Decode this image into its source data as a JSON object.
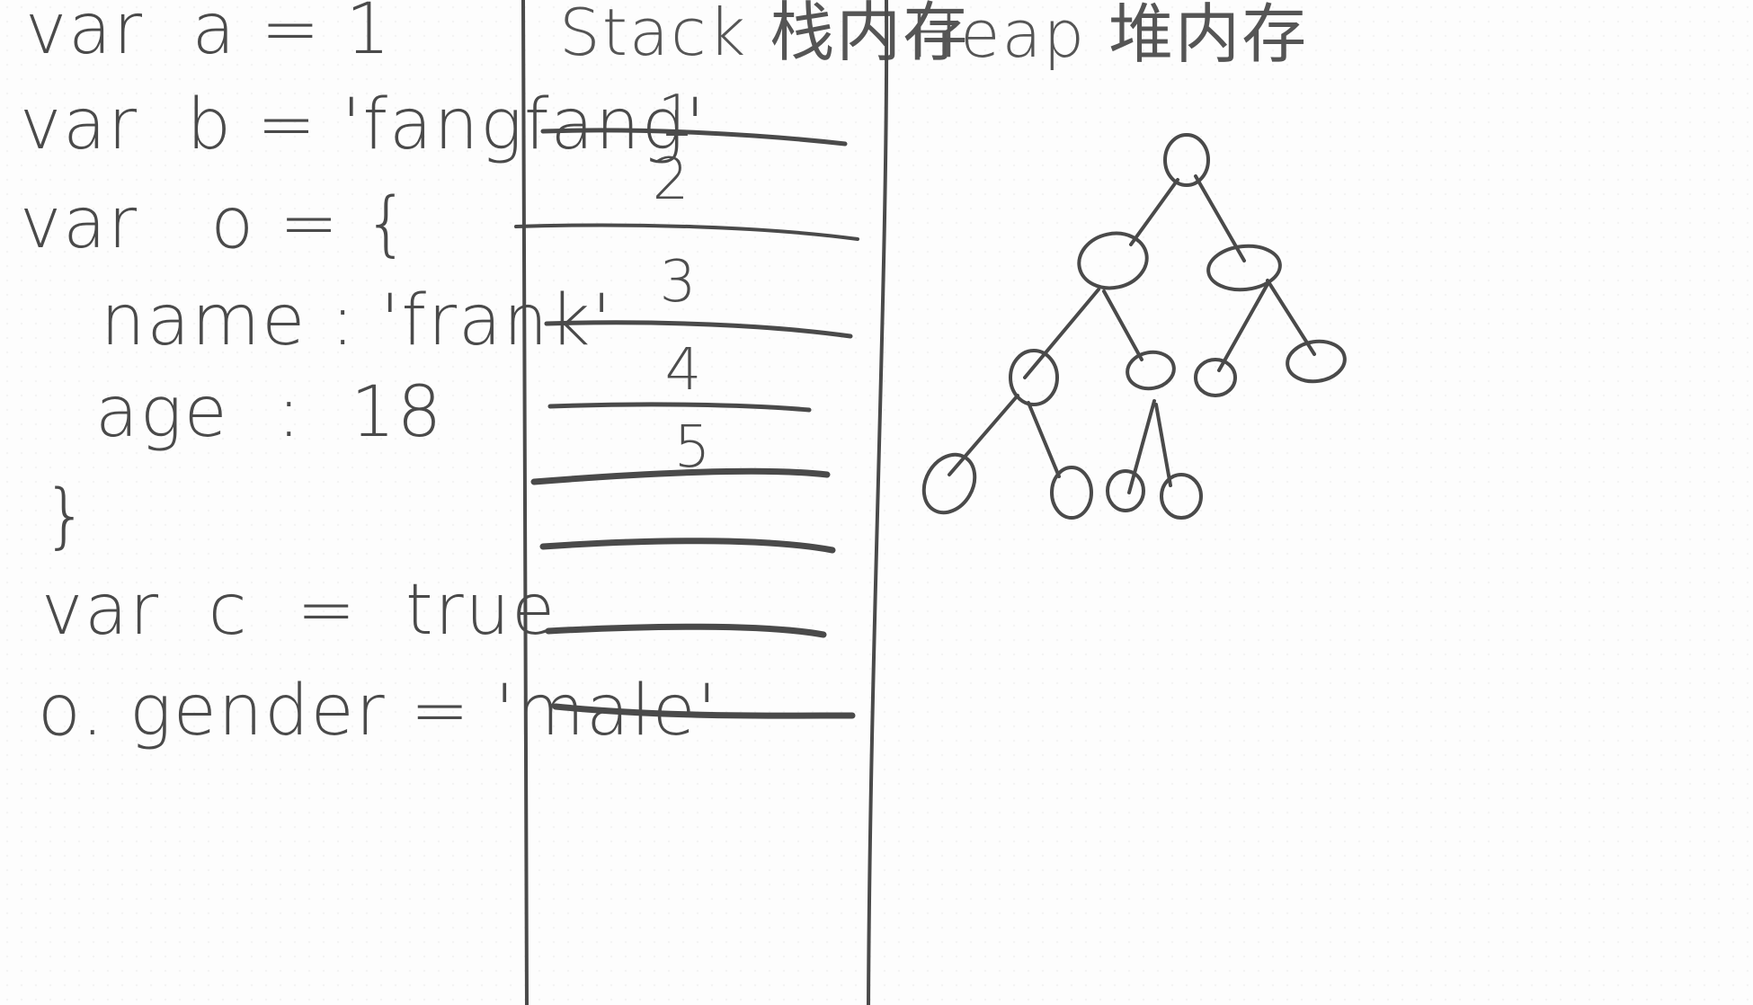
{
  "code_lines": [
    "var  a = 1",
    "var  b = 'fangfang'",
    "var   o = {",
    "name : 'frank'",
    "age  :  18",
    "}",
    "var  c  =  true",
    "o. gender = 'male'"
  ],
  "stack": {
    "title": "Stack 栈内存",
    "numbers": [
      "1",
      "2",
      "3",
      "4",
      "5"
    ]
  },
  "heap": {
    "title": "Heap 堆内存"
  },
  "colors": {
    "ink": "#4a4a4a",
    "board": "#fdfdfd"
  }
}
